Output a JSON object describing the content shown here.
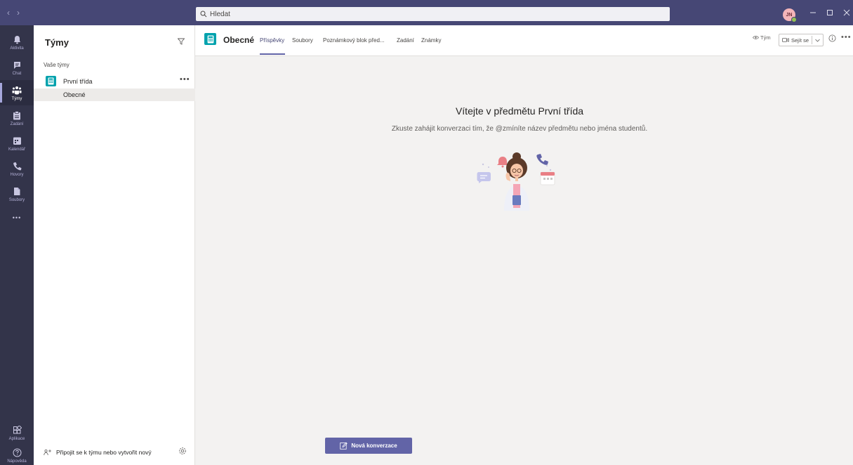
{
  "titlebar": {
    "back_arrow": "‹",
    "forward_arrow": "›",
    "search_placeholder": "Hledat",
    "avatar_initials": "JN"
  },
  "rail": {
    "items": [
      {
        "label": "Aktivita",
        "icon": "bell-icon"
      },
      {
        "label": "Chat",
        "icon": "chat-icon"
      },
      {
        "label": "Týmy",
        "icon": "teams-icon"
      },
      {
        "label": "Zadání",
        "icon": "assignments-icon"
      },
      {
        "label": "Kalendář",
        "icon": "calendar-icon"
      },
      {
        "label": "Hovory",
        "icon": "phone-icon"
      },
      {
        "label": "Soubory",
        "icon": "files-icon"
      }
    ],
    "more": "•••",
    "apps_label": "Aplikace",
    "help_label": "Nápověda"
  },
  "teams_panel": {
    "title": "Týmy",
    "section_label": "Vaše týmy",
    "team_name": "První třída",
    "team_more": "•••",
    "channel_name": "Obecné",
    "join_label": "Připojit se k týmu nebo vytvořit nový"
  },
  "channel_header": {
    "title": "Obecné",
    "tabs": [
      "Příspěvky",
      "Soubory",
      "Poznámkový blok před...",
      "Zadání",
      "Známky"
    ],
    "team_button": "Tým",
    "meet_button": "Sejít se"
  },
  "welcome": {
    "title": "Vítejte v předmětu První třída",
    "subtitle": "Zkuste zahájit konverzaci tím, že @zmíníte název předmětu nebo jména studentů."
  },
  "compose": {
    "new_conversation_label": "Nová konverzace"
  },
  "colors": {
    "titlebar": "#464775",
    "rail": "#33344a",
    "accent": "#6264a7",
    "team_icon": "#00a2ad",
    "presence": "#92c353"
  }
}
